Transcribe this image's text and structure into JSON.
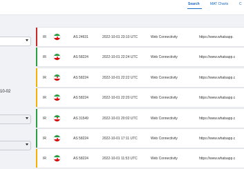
{
  "nav": {
    "search": "Search",
    "mat_charts": "MAT Charts",
    "more": "C"
  },
  "sidebar": {
    "date_fragment": "10-02"
  },
  "colors": {
    "accent": "#1666c4",
    "anomaly": "#f0b400",
    "confirmed": "#c62828",
    "ok": "#2e9a45"
  },
  "rows": [
    {
      "status": "confirmed",
      "country": "IR",
      "flag_icon": "iran-flag-icon",
      "asn": "AS 24631",
      "date": "2022-10-01 23:10 UTC",
      "test": "Web Connectivity",
      "url": "https://www.whatsapp."
    },
    {
      "status": "ok",
      "country": "IR",
      "flag_icon": "iran-flag-icon",
      "asn": "AS 58224",
      "date": "2022-10-01 22:24 UTC",
      "test": "Web Connectivity",
      "url": "https://www.whatsapp.c"
    },
    {
      "status": "anomaly",
      "country": "IR",
      "flag_icon": "iran-flag-icon",
      "asn": "AS 58224",
      "date": "2022-10-01 22:22 UTC",
      "test": "Web Connectivity",
      "url": "https://www.whatsapp.c"
    },
    {
      "status": "anomaly",
      "country": "IR",
      "flag_icon": "iran-flag-icon",
      "asn": "AS 58224",
      "date": "2022-10-01 22:20 UTC",
      "test": "Web Connectivity",
      "url": "https://www.whatsapp.c"
    },
    {
      "status": "ok",
      "country": "IR",
      "flag_icon": "iran-flag-icon",
      "asn": "AS 31549",
      "date": "2022-10-01 20:02 UTC",
      "test": "Web Connectivity",
      "url": "https://www.whatsapp.c"
    },
    {
      "status": "ok",
      "country": "IR",
      "flag_icon": "iran-flag-icon",
      "asn": "AS 58224",
      "date": "2022-10-01 17:11 UTC",
      "test": "Web Connectivity",
      "url": "https://www.whatsapp.c"
    },
    {
      "status": "anomaly",
      "country": "IR",
      "flag_icon": "iran-flag-icon",
      "asn": "AS 58224",
      "date": "2022-10-01 11:53 UTC",
      "test": "Web Connectivity",
      "url": "https://www.whatsapp.c"
    }
  ]
}
